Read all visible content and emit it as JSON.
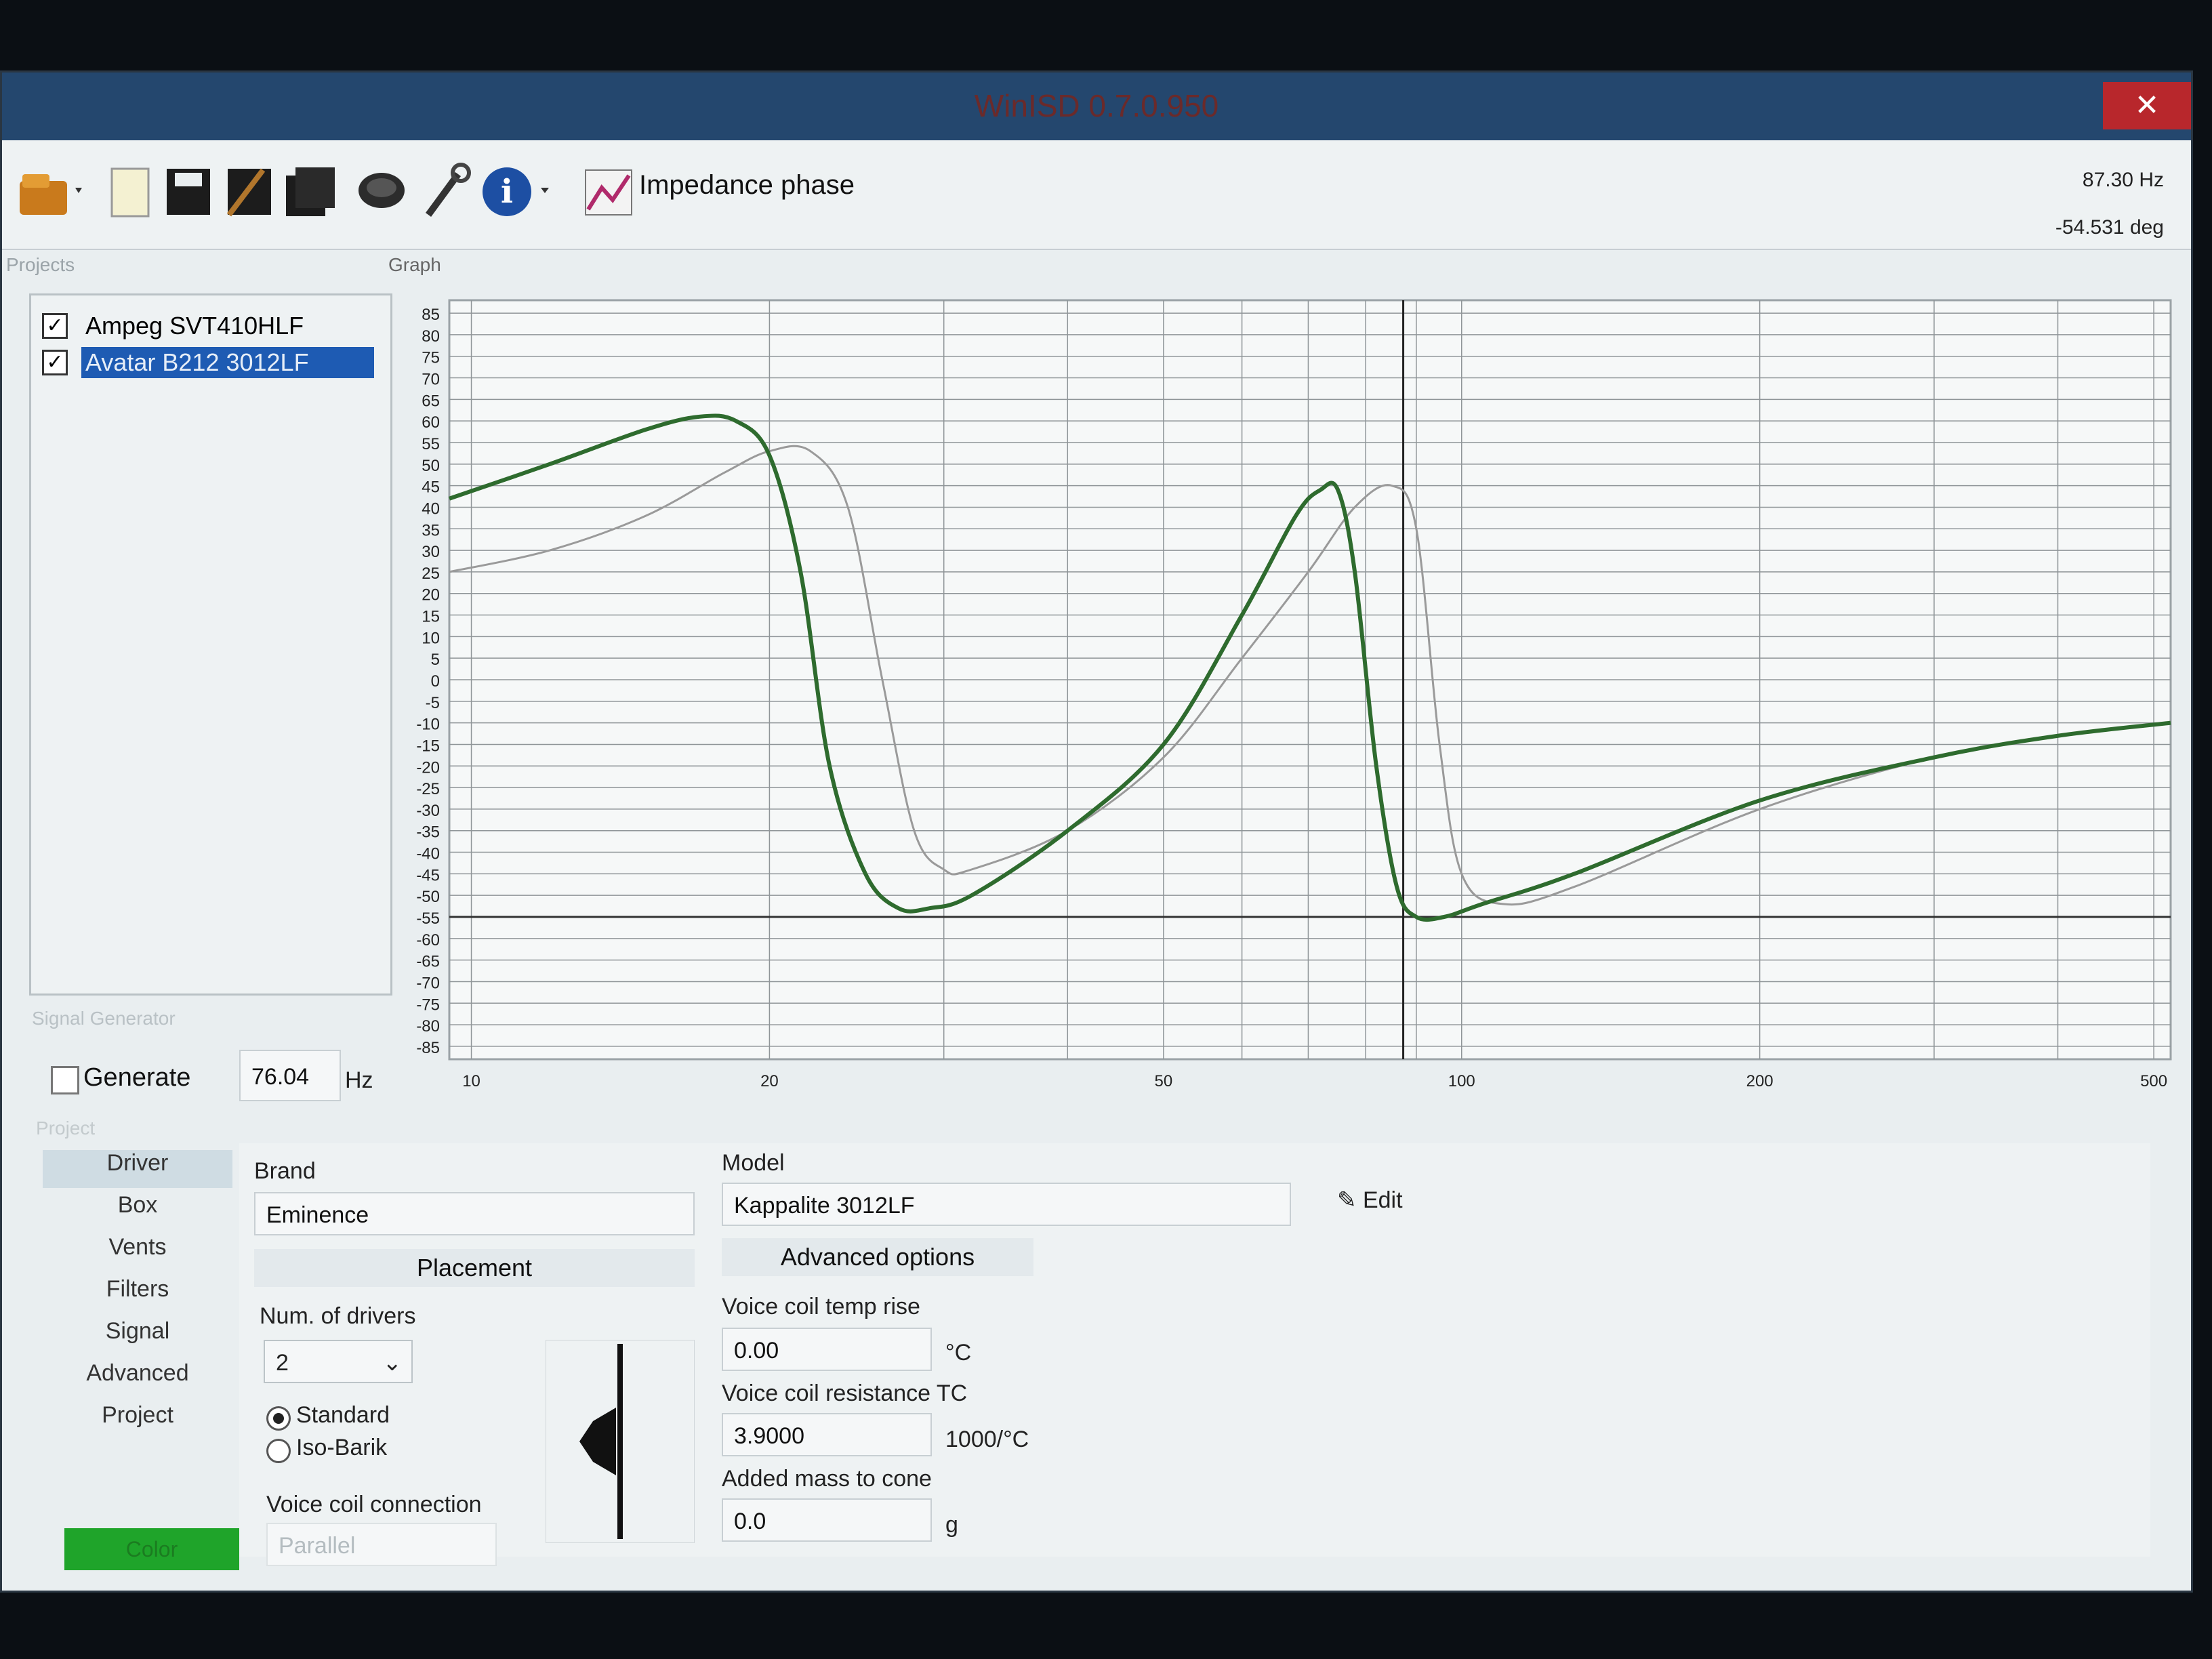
{
  "window": {
    "title": "WinISD 0.7.0.950",
    "close_glyph": "✕"
  },
  "toolbar": {
    "graph_type_label": "Impedance phase",
    "icons": [
      "open-folder-icon",
      "new-file-icon",
      "save-icon",
      "save-as-icon",
      "save-all-icon",
      "speaker-icon",
      "tools-icon",
      "info-icon",
      "graph-icon"
    ]
  },
  "readout": {
    "frequency": "87.30 Hz",
    "phase": "-54.531 deg"
  },
  "sections": {
    "projects": "Projects",
    "graph": "Graph",
    "signal_generator": "Signal Generator",
    "project": "Project"
  },
  "projects": [
    {
      "name": "Ampeg SVT410HLF",
      "checked": true,
      "selected": false
    },
    {
      "name": "Avatar B212 3012LF",
      "checked": true,
      "selected": true
    }
  ],
  "signal_generator": {
    "generate_label": "Generate",
    "generate_checked": false,
    "frequency_value": "76.04",
    "unit": "Hz"
  },
  "nav": [
    "Driver",
    "Box",
    "Vents",
    "Filters",
    "Signal",
    "Advanced",
    "Project"
  ],
  "nav_active": "Driver",
  "driver": {
    "brand_label": "Brand",
    "brand_value": "Eminence",
    "model_label": "Model",
    "model_value": "Kappalite 3012LF",
    "edit_label": "Edit",
    "placement_header": "Placement",
    "num_drivers_label": "Num. of drivers",
    "num_drivers_value": "2",
    "standard_label": "Standard",
    "isobarik_label": "Iso-Barik",
    "voice_coil_connection_label": "Voice coil connection",
    "voice_coil_connection_value": "Parallel",
    "advanced_header": "Advanced options",
    "vc_temp_rise_label": "Voice coil temp rise",
    "vc_temp_rise_value": "0.00",
    "vc_temp_rise_unit": "°C",
    "vc_res_tc_label": "Voice coil resistance TC",
    "vc_res_tc_value": "3.9000",
    "vc_res_tc_unit": "1000/°C",
    "added_mass_label": "Added mass to cone",
    "added_mass_value": "0.0",
    "added_mass_unit": "g"
  },
  "color_button_label": "Color",
  "colors": {
    "series_current": "#2e6b2e",
    "series_other": "#9a9a9a",
    "color_button": "#1fa42a",
    "selection": "#1e5bb3"
  },
  "chart_data": {
    "type": "line",
    "xlabel": "",
    "ylabel": "",
    "x_scale": "log",
    "xlim": [
      9.5,
      520
    ],
    "ylim": [
      -88,
      88
    ],
    "x_ticks": [
      10,
      20,
      50,
      100,
      200,
      500
    ],
    "y_ticks": [
      85,
      80,
      75,
      70,
      65,
      60,
      55,
      50,
      45,
      40,
      35,
      30,
      25,
      20,
      15,
      10,
      5,
      0,
      -5,
      -10,
      -15,
      -20,
      -25,
      -30,
      -35,
      -40,
      -45,
      -50,
      -55,
      -60,
      -65,
      -70,
      -75,
      -80,
      -85
    ],
    "cursor_x": 87.3,
    "series": [
      {
        "color": "#2e6b2e",
        "x": [
          9.5,
          12,
          15,
          17,
          18.5,
          20,
          21.5,
          23,
          25,
          27,
          29,
          32,
          40,
          50,
          60,
          68,
          72,
          75,
          78,
          82,
          86,
          90,
          96,
          105,
          130,
          200,
          300,
          400,
          520
        ],
        "y": [
          42,
          50,
          58,
          61,
          60,
          52,
          25,
          -20,
          -45,
          -53,
          -53,
          -50,
          -35,
          -15,
          15,
          38,
          44,
          44,
          25,
          -20,
          -48,
          -55,
          -55,
          -52,
          -45,
          -28,
          -18,
          -13,
          -10
        ]
      },
      {
        "color": "#9a9a9a",
        "x": [
          9.5,
          12,
          15,
          18,
          20,
          22,
          24,
          26,
          28,
          30,
          32,
          40,
          50,
          60,
          70,
          78,
          85,
          90,
          95,
          100,
          110,
          130,
          200,
          300,
          400,
          520
        ],
        "y": [
          25,
          30,
          38,
          48,
          53,
          53,
          40,
          0,
          -35,
          -44,
          -44,
          -35,
          -18,
          5,
          25,
          40,
          45,
          35,
          -15,
          -45,
          -52,
          -48,
          -30,
          -18,
          -13,
          -10
        ]
      }
    ]
  }
}
